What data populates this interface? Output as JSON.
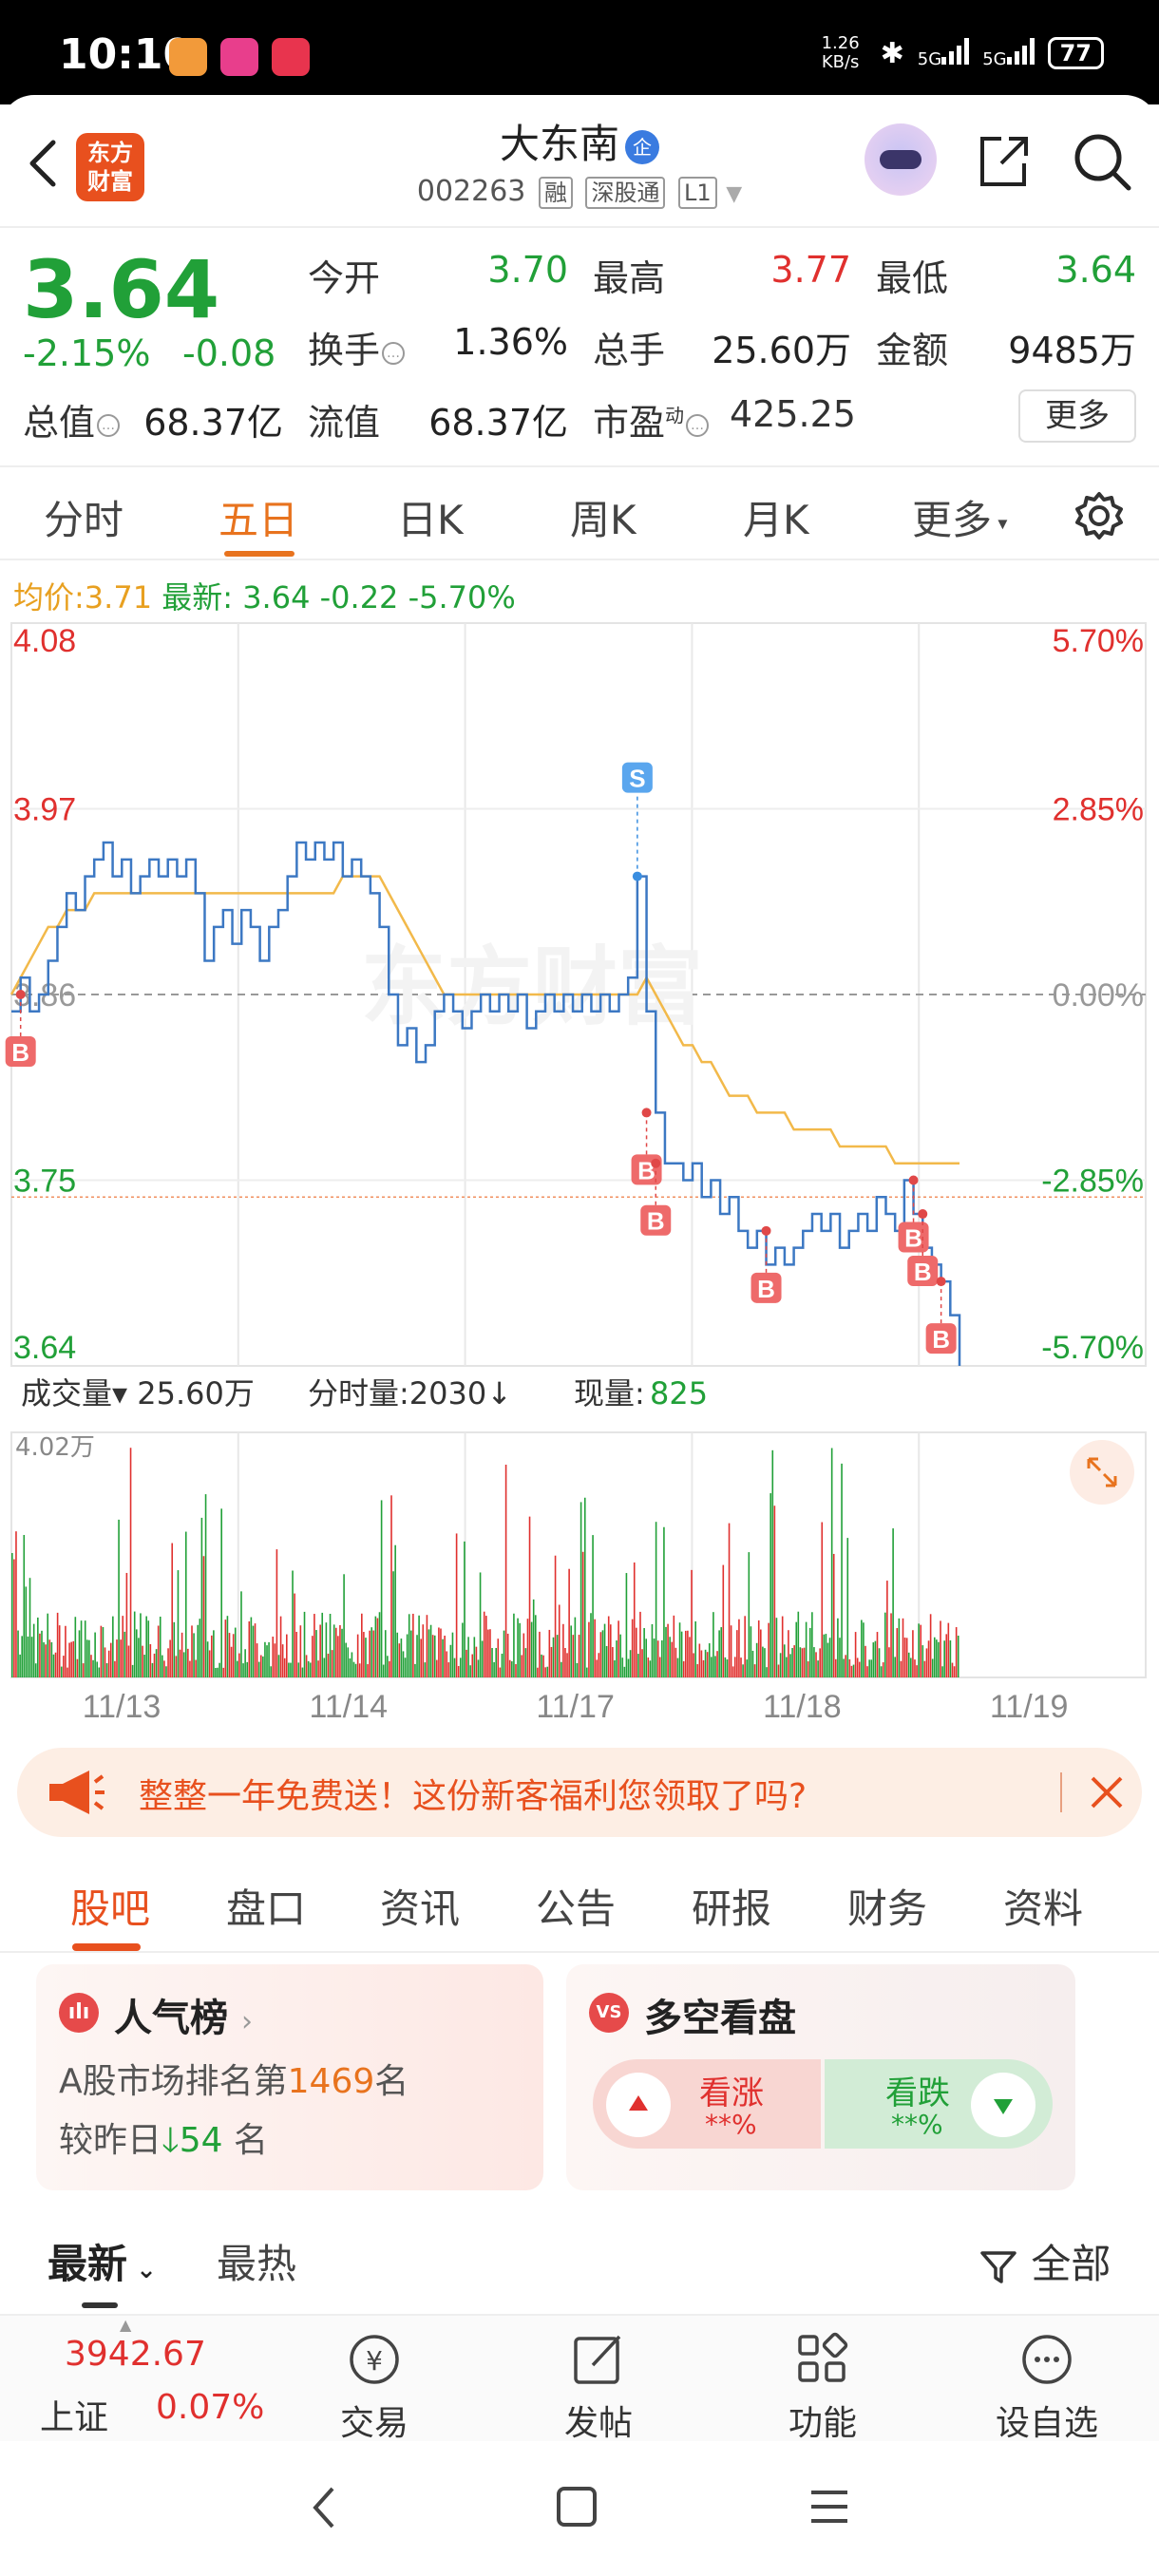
{
  "status_bar": {
    "time": "10:10",
    "net_speed": "1.26 KB/s",
    "signal_1": "5G",
    "signal_2": "5G",
    "battery": "77"
  },
  "header": {
    "brand_logo": "东方\n财富",
    "stock_name": "大东南",
    "badge": "企",
    "stock_code": "002263",
    "tags": [
      "融",
      "深股通",
      "L1"
    ]
  },
  "quote": {
    "price": "3.64",
    "change_pct": "-2.15%",
    "change": "-0.08",
    "open_label": "今开",
    "open": "3.70",
    "high_label": "最高",
    "high": "3.77",
    "low_label": "最低",
    "low": "3.64",
    "turnover_label": "换手",
    "turnover": "1.36%",
    "volume_label": "总手",
    "volume": "25.60万",
    "amount_label": "金额",
    "amount": "9485万",
    "mcap_label": "总值",
    "mcap": "68.37亿",
    "float_label": "流值",
    "float": "68.37亿",
    "pe_label": "市盈",
    "pe_sup": "动",
    "pe": "425.25",
    "more_label": "更多"
  },
  "period_tabs": [
    "分时",
    "五日",
    "日K",
    "周K",
    "月K",
    "更多"
  ],
  "period_active": 1,
  "chart_legend": {
    "avg_label": "均价:",
    "avg": "3.71",
    "last_label": "最新:",
    "last": "3.64",
    "last_change": "-0.22",
    "last_pct": "-5.70%"
  },
  "volume_legend": {
    "vol_label": "成交量",
    "vol_value": "25.60万",
    "min_vol_label": "分时量:",
    "min_vol": "2030",
    "now_label": "现量:",
    "now": "825",
    "vol_axis_max": "4.02万"
  },
  "chart_data": {
    "type": "line",
    "series": [
      {
        "values": [
          3.85,
          3.87,
          3.85,
          3.86,
          3.88,
          3.9,
          3.92,
          3.91,
          3.93,
          3.94,
          3.95,
          3.93,
          3.94,
          3.92,
          3.93,
          3.94,
          3.93,
          3.94,
          3.93,
          3.94,
          3.92,
          3.88,
          3.9,
          3.91,
          3.89,
          3.91,
          3.9,
          3.88,
          3.9,
          3.91,
          3.93,
          3.95,
          3.94,
          3.95,
          3.94,
          3.95,
          3.93,
          3.94,
          3.93,
          3.92,
          3.9,
          3.86,
          3.83,
          3.84,
          3.82,
          3.83,
          3.85,
          3.86,
          3.85,
          3.84,
          3.85,
          3.86,
          3.85,
          3.86,
          3.85,
          3.86,
          3.84,
          3.85,
          3.86,
          3.85,
          3.86,
          3.85,
          3.86,
          3.85,
          3.86,
          3.85,
          3.86,
          3.87,
          3.93,
          3.85,
          3.79,
          3.76,
          3.76,
          3.75,
          3.76,
          3.74,
          3.75,
          3.73,
          3.74,
          3.72,
          3.71,
          3.72,
          3.7,
          3.71,
          3.7,
          3.71,
          3.72,
          3.73,
          3.72,
          3.73,
          3.71,
          3.72,
          3.73,
          3.72,
          3.74,
          3.73,
          3.72,
          3.75,
          3.73,
          3.71,
          3.7,
          3.69,
          3.67,
          3.64
        ]
      },
      {
        "values": [
          3.86,
          3.87,
          3.88,
          3.89,
          3.9,
          3.9,
          3.91,
          3.91,
          3.91,
          3.92,
          3.92,
          3.92,
          3.92,
          3.92,
          3.92,
          3.92,
          3.92,
          3.92,
          3.92,
          3.92,
          3.92,
          3.92,
          3.92,
          3.92,
          3.92,
          3.92,
          3.92,
          3.92,
          3.92,
          3.92,
          3.92,
          3.92,
          3.92,
          3.92,
          3.92,
          3.92,
          3.93,
          3.93,
          3.93,
          3.93,
          3.93,
          3.92,
          3.91,
          3.9,
          3.89,
          3.88,
          3.87,
          3.86,
          3.86,
          3.86,
          3.86,
          3.86,
          3.86,
          3.86,
          3.86,
          3.86,
          3.86,
          3.86,
          3.86,
          3.86,
          3.86,
          3.86,
          3.86,
          3.86,
          3.86,
          3.86,
          3.86,
          3.86,
          3.86,
          3.87,
          3.86,
          3.85,
          3.84,
          3.83,
          3.83,
          3.82,
          3.82,
          3.81,
          3.8,
          3.8,
          3.8,
          3.79,
          3.79,
          3.79,
          3.79,
          3.78,
          3.78,
          3.78,
          3.78,
          3.78,
          3.77,
          3.77,
          3.77,
          3.77,
          3.77,
          3.77,
          3.76,
          3.76,
          3.76,
          3.76,
          3.76,
          3.76,
          3.76,
          3.76
        ]
      }
    ],
    "x_ticks": [
      "11/13",
      "11/14",
      "11/17",
      "11/18",
      "11/19"
    ],
    "y_ticks_left": [
      "4.08",
      "3.97",
      "3.86",
      "3.75",
      "3.64"
    ],
    "y_ticks_right": [
      "5.70%",
      "2.85%",
      "0.00%",
      "-2.85%",
      "-5.70%"
    ],
    "ylim": [
      3.64,
      4.08
    ],
    "prev_close": 3.86,
    "trade_markers": [
      {
        "label": "B",
        "x": 1,
        "y": 3.86
      },
      {
        "label": "S",
        "x": 68,
        "y": 3.93
      },
      {
        "label": "B",
        "x": 69,
        "y": 3.79
      },
      {
        "label": "B",
        "x": 70,
        "y": 3.76
      },
      {
        "label": "B",
        "x": 82,
        "y": 3.72
      },
      {
        "label": "B",
        "x": 98,
        "y": 3.75
      },
      {
        "label": "B",
        "x": 99,
        "y": 3.73
      },
      {
        "label": "B",
        "x": 101,
        "y": 3.69
      }
    ],
    "colors": {
      "price": "#3c78c3",
      "avg": "#f2b94a",
      "up": "#e0302e",
      "down": "#21a038"
    }
  },
  "banner": {
    "text": "整整一年免费送！这份新客福利您领取了吗?"
  },
  "content_tabs": [
    "股吧",
    "盘口",
    "资讯",
    "公告",
    "研报",
    "财务",
    "资料"
  ],
  "popularity": {
    "title": "人气榜",
    "line1_prefix": "A股市场排名第",
    "rank": "1469",
    "line1_suffix": "名",
    "line2_prefix": "较昨日",
    "delta": "54",
    "line2_suffix": "名"
  },
  "long_short": {
    "title": "多空看盘",
    "up_label": "看涨",
    "up_value": "**%",
    "down_label": "看跌",
    "down_value": "**%"
  },
  "feed": {
    "latest": "最新",
    "hottest": "最热",
    "filter": "全部"
  },
  "bottom_bar": {
    "index_value": "3942.67",
    "index_name": "上证",
    "index_pct": "0.07%",
    "items": [
      "交易",
      "发帖",
      "功能",
      "设自选"
    ]
  }
}
